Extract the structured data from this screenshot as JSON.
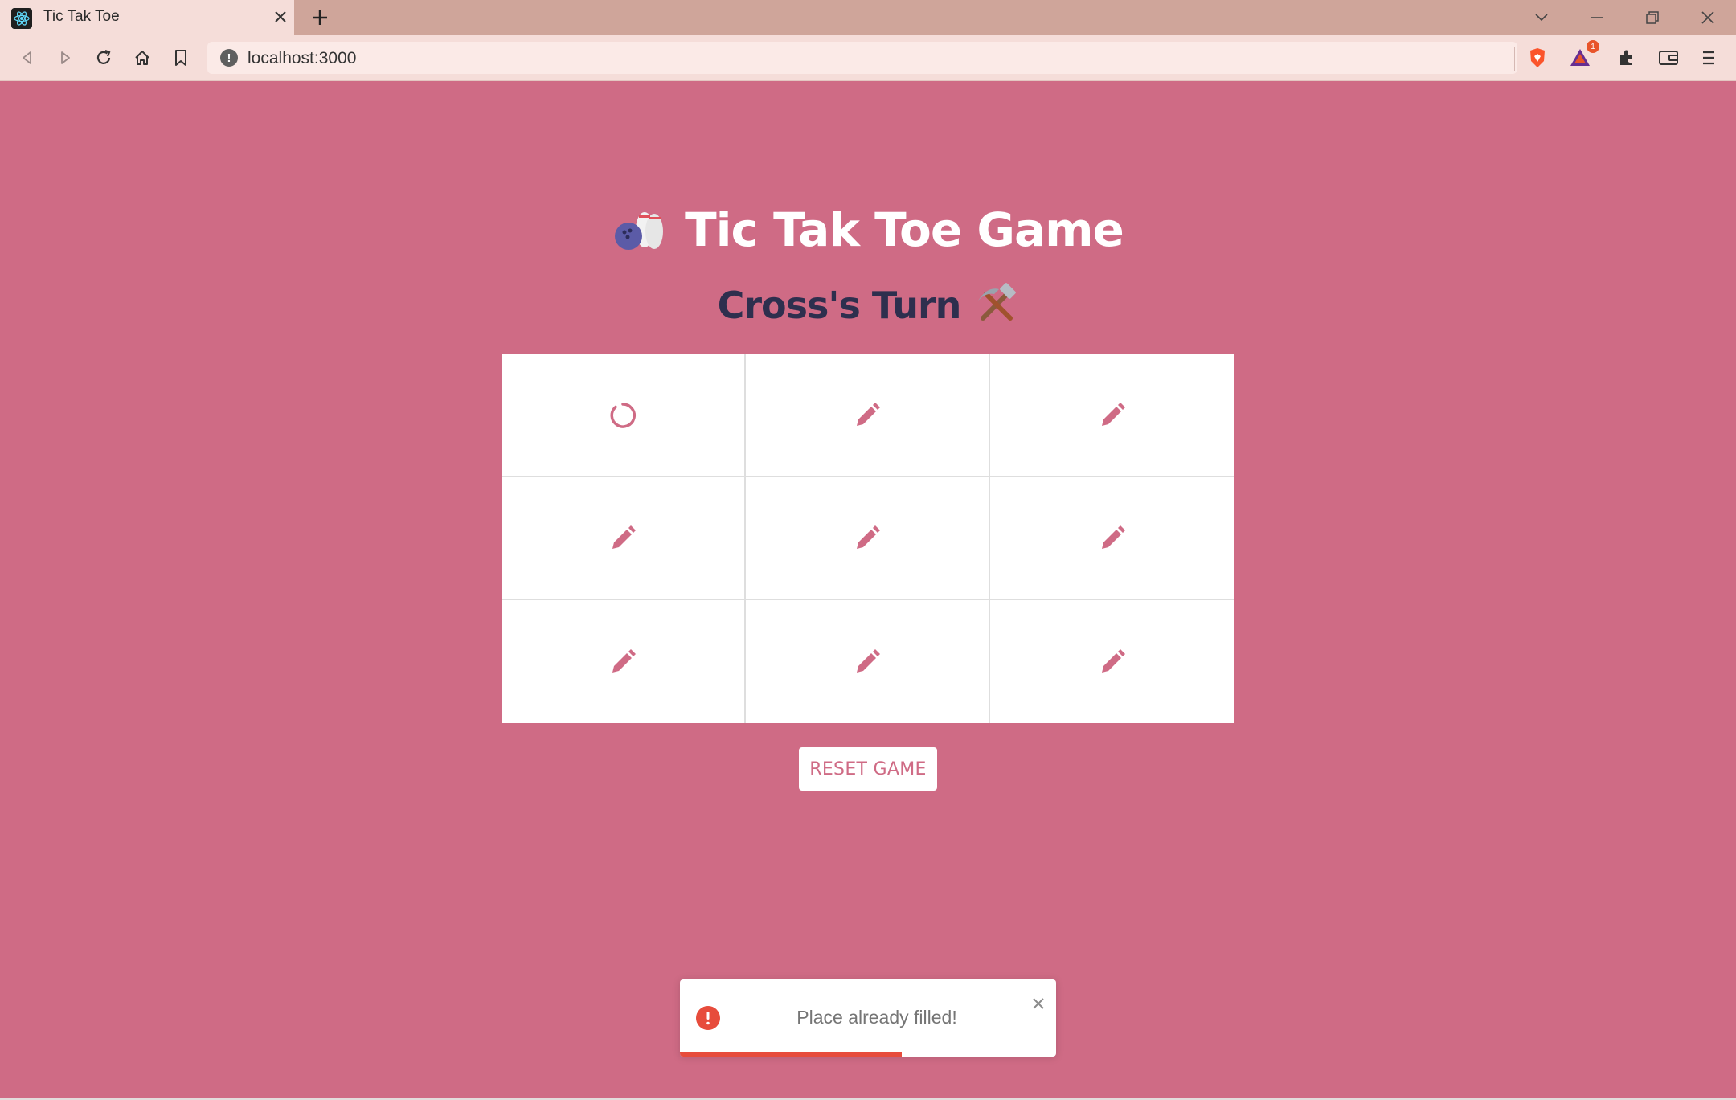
{
  "browser": {
    "tab_title": "Tic Tak Toe",
    "url": "localhost:3000",
    "url_info_glyph": "!",
    "notification_count": "1"
  },
  "page": {
    "title": "Tic Tak Toe Game",
    "turn_text": "Cross's Turn",
    "board": [
      {
        "state": "circle"
      },
      {
        "state": "empty"
      },
      {
        "state": "empty"
      },
      {
        "state": "empty"
      },
      {
        "state": "empty"
      },
      {
        "state": "empty"
      },
      {
        "state": "empty"
      },
      {
        "state": "empty"
      },
      {
        "state": "empty"
      }
    ],
    "reset_label": "RESET GAME"
  },
  "toast": {
    "message": "Place already filled!",
    "type": "error",
    "progress_remaining": 0.59
  },
  "colors": {
    "background": "#cf6b85",
    "accent": "#cf6b85",
    "turn_text": "#2e2f4e",
    "error": "#e74c3c"
  }
}
